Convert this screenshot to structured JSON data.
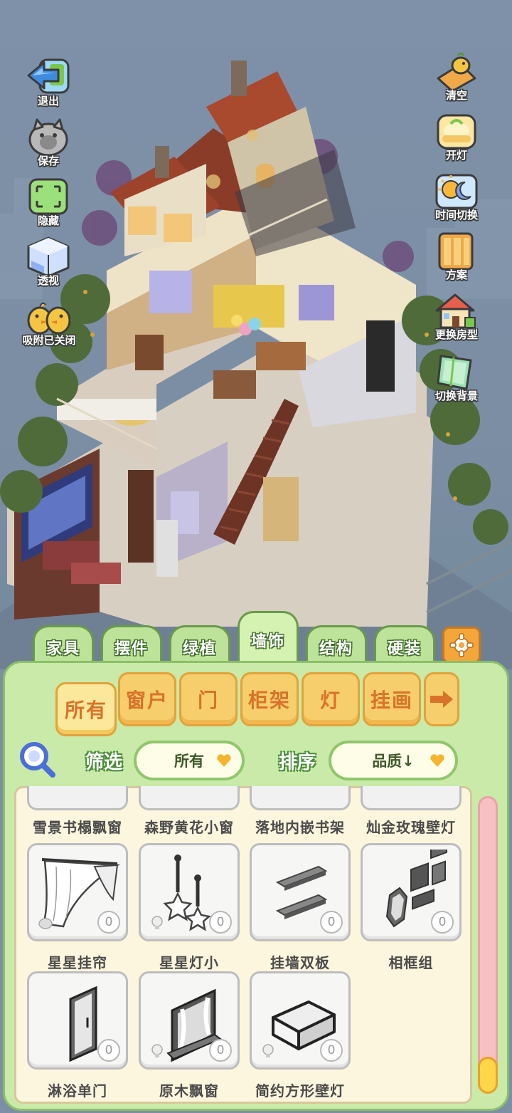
{
  "side_left": [
    {
      "label": "退出",
      "icon": "exit-arrow-icon"
    },
    {
      "label": "保存",
      "icon": "cat-save-icon"
    },
    {
      "label": "隐藏",
      "icon": "hide-frame-icon"
    },
    {
      "label": "透视",
      "icon": "cube-see-through-icon"
    },
    {
      "label": "吸附已关闭",
      "icon": "duck-snap-icon"
    }
  ],
  "side_right": [
    {
      "label": "清空",
      "icon": "broom-duck-icon"
    },
    {
      "label": "开灯",
      "icon": "lamp-icon"
    },
    {
      "label": "时间切换",
      "icon": "sun-moon-icon"
    },
    {
      "label": "方案",
      "icon": "blueprint-icon"
    },
    {
      "label": "更换房型",
      "icon": "house-icon"
    },
    {
      "label": "切换背景",
      "icon": "background-card-icon"
    }
  ],
  "categories": [
    {
      "label": "家具"
    },
    {
      "label": "摆件"
    },
    {
      "label": "绿植"
    },
    {
      "label": "墙饰",
      "active": true
    },
    {
      "label": "结构"
    },
    {
      "label": "硬装"
    }
  ],
  "subtabs": [
    {
      "label": "所有",
      "active": true
    },
    {
      "label": "窗户"
    },
    {
      "label": "门"
    },
    {
      "label": "柜架"
    },
    {
      "label": "灯"
    },
    {
      "label": "挂画"
    }
  ],
  "filter": {
    "label": "筛选",
    "value": "所有"
  },
  "sort": {
    "label": "排序",
    "value": "品质↓"
  },
  "partial_items": [
    {
      "name": "雪景书榻飘窗"
    },
    {
      "name": "森野黄花小窗"
    },
    {
      "name": "落地内嵌书架"
    },
    {
      "name": "灿金玫瑰壁灯"
    }
  ],
  "items": [
    {
      "name": "星星挂帘",
      "count": "0",
      "art": "curtain-icon",
      "tag": "bean"
    },
    {
      "name": "星星灯小",
      "count": "0",
      "art": "star-lamp-icon",
      "tag": "bulb"
    },
    {
      "name": "挂墙双板",
      "count": "0",
      "art": "wall-shelf-icon",
      "tag": ""
    },
    {
      "name": "相框组",
      "count": "0",
      "art": "photo-frames-icon",
      "tag": ""
    },
    {
      "name": "淋浴单门",
      "count": "0",
      "art": "shower-door-icon",
      "tag": ""
    },
    {
      "name": "原木飘窗",
      "count": "0",
      "art": "wood-window-icon",
      "tag": "bulb"
    },
    {
      "name": "简约方形壁灯",
      "count": "0",
      "art": "square-wall-lamp-icon",
      "tag": "bulb"
    }
  ],
  "colors": {
    "panel_green": "#c9eaa8",
    "tab_green": "#bde39a",
    "subtab_orange": "#f7ce6c",
    "gear_orange": "#f5a63a",
    "sky": "#7f91a8"
  }
}
